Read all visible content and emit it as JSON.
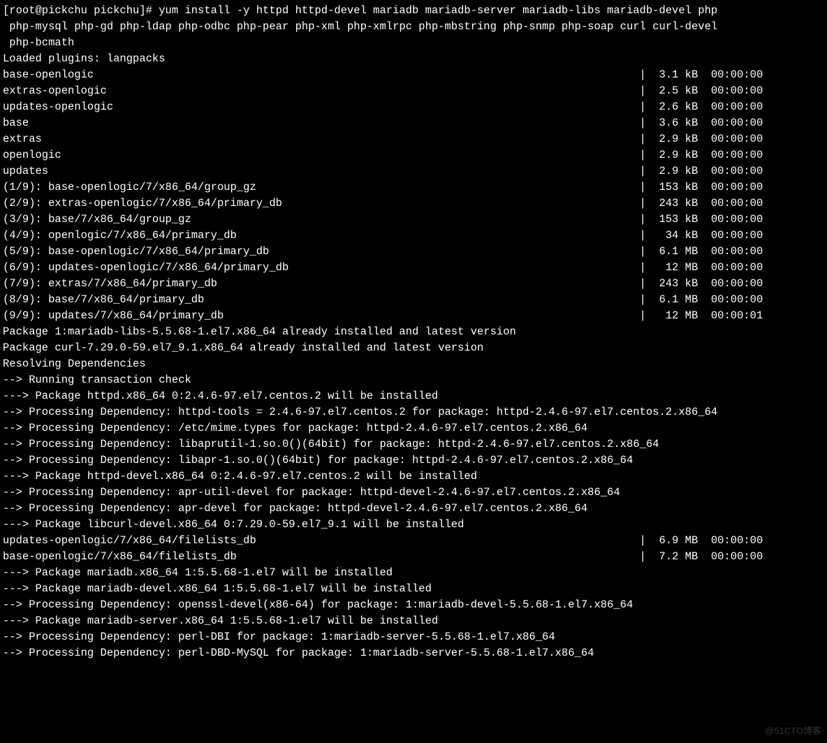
{
  "prompt": "[root@pickchu pickchu]# ",
  "command_lines": [
    "yum install -y httpd httpd-devel mariadb mariadb-server mariadb-libs mariadb-devel php",
    " php-mysql php-gd php-ldap php-odbc php-pear php-xml php-xmlrpc php-mbstring php-snmp php-soap curl curl-devel",
    " php-bcmath"
  ],
  "loaded_plugins": "Loaded plugins: langpacks",
  "repo_lines": [
    {
      "name": "base-openlogic",
      "size": "3.1 kB",
      "time": "00:00:00"
    },
    {
      "name": "extras-openlogic",
      "size": "2.5 kB",
      "time": "00:00:00"
    },
    {
      "name": "updates-openlogic",
      "size": "2.6 kB",
      "time": "00:00:00"
    }
  ],
  "repo_lines2": [
    {
      "name": "base",
      "size": "3.6 kB",
      "time": "00:00:00"
    },
    {
      "name": "extras",
      "size": "2.9 kB",
      "time": "00:00:00"
    },
    {
      "name": "openlogic",
      "size": "2.9 kB",
      "time": "00:00:00"
    },
    {
      "name": "updates",
      "size": "2.9 kB",
      "time": "00:00:00"
    }
  ],
  "downloads": [
    {
      "name": "(1/9): base-openlogic/7/x86_64/group_gz",
      "size": "153 kB",
      "time": "00:00:00"
    },
    {
      "name": "(2/9): extras-openlogic/7/x86_64/primary_db",
      "size": "243 kB",
      "time": "00:00:00"
    },
    {
      "name": "(3/9): base/7/x86_64/group_gz",
      "size": "153 kB",
      "time": "00:00:00"
    },
    {
      "name": "(4/9): openlogic/7/x86_64/primary_db",
      "size": " 34 kB",
      "time": "00:00:00"
    },
    {
      "name": "(5/9): base-openlogic/7/x86_64/primary_db",
      "size": "6.1 MB",
      "time": "00:00:00"
    },
    {
      "name": "(6/9): updates-openlogic/7/x86_64/primary_db",
      "size": " 12 MB",
      "time": "00:00:00"
    },
    {
      "name": "(7/9): extras/7/x86_64/primary_db",
      "size": "243 kB",
      "time": "00:00:00"
    },
    {
      "name": "(8/9): base/7/x86_64/primary_db",
      "size": "6.1 MB",
      "time": "00:00:00"
    },
    {
      "name": "(9/9): updates/7/x86_64/primary_db",
      "size": " 12 MB",
      "time": "00:00:01"
    }
  ],
  "already_installed": [
    "Package 1:mariadb-libs-5.5.68-1.el7.x86_64 already installed and latest version",
    "Package curl-7.29.0-59.el7_9.1.x86_64 already installed and latest version"
  ],
  "resolving": "Resolving Dependencies",
  "dep_lines": [
    "--> Running transaction check",
    "---> Package httpd.x86_64 0:2.4.6-97.el7.centos.2 will be installed",
    "--> Processing Dependency: httpd-tools = 2.4.6-97.el7.centos.2 for package: httpd-2.4.6-97.el7.centos.2.x86_64",
    "--> Processing Dependency: /etc/mime.types for package: httpd-2.4.6-97.el7.centos.2.x86_64",
    "--> Processing Dependency: libaprutil-1.so.0()(64bit) for package: httpd-2.4.6-97.el7.centos.2.x86_64",
    "--> Processing Dependency: libapr-1.so.0()(64bit) for package: httpd-2.4.6-97.el7.centos.2.x86_64",
    "---> Package httpd-devel.x86_64 0:2.4.6-97.el7.centos.2 will be installed",
    "--> Processing Dependency: apr-util-devel for package: httpd-devel-2.4.6-97.el7.centos.2.x86_64",
    "--> Processing Dependency: apr-devel for package: httpd-devel-2.4.6-97.el7.centos.2.x86_64",
    "---> Package libcurl-devel.x86_64 0:7.29.0-59.el7_9.1 will be installed"
  ],
  "filelists": [
    {
      "name": "updates-openlogic/7/x86_64/filelists_db",
      "size": "6.9 MB",
      "time": "00:00:00"
    },
    {
      "name": "base-openlogic/7/x86_64/filelists_db",
      "size": "7.2 MB",
      "time": "00:00:00"
    }
  ],
  "dep_lines2": [
    "---> Package mariadb.x86_64 1:5.5.68-1.el7 will be installed",
    "---> Package mariadb-devel.x86_64 1:5.5.68-1.el7 will be installed",
    "--> Processing Dependency: openssl-devel(x86-64) for package: 1:mariadb-devel-5.5.68-1.el7.x86_64",
    "---> Package mariadb-server.x86_64 1:5.5.68-1.el7 will be installed",
    "--> Processing Dependency: perl-DBI for package: 1:mariadb-server-5.5.68-1.el7.x86_64",
    "--> Processing Dependency: perl-DBD-MySQL for package: 1:mariadb-server-5.5.68-1.el7.x86_64"
  ],
  "watermark": "@51CTO博客",
  "layout": {
    "left_col_width": 98,
    "size_col_width": 7
  }
}
